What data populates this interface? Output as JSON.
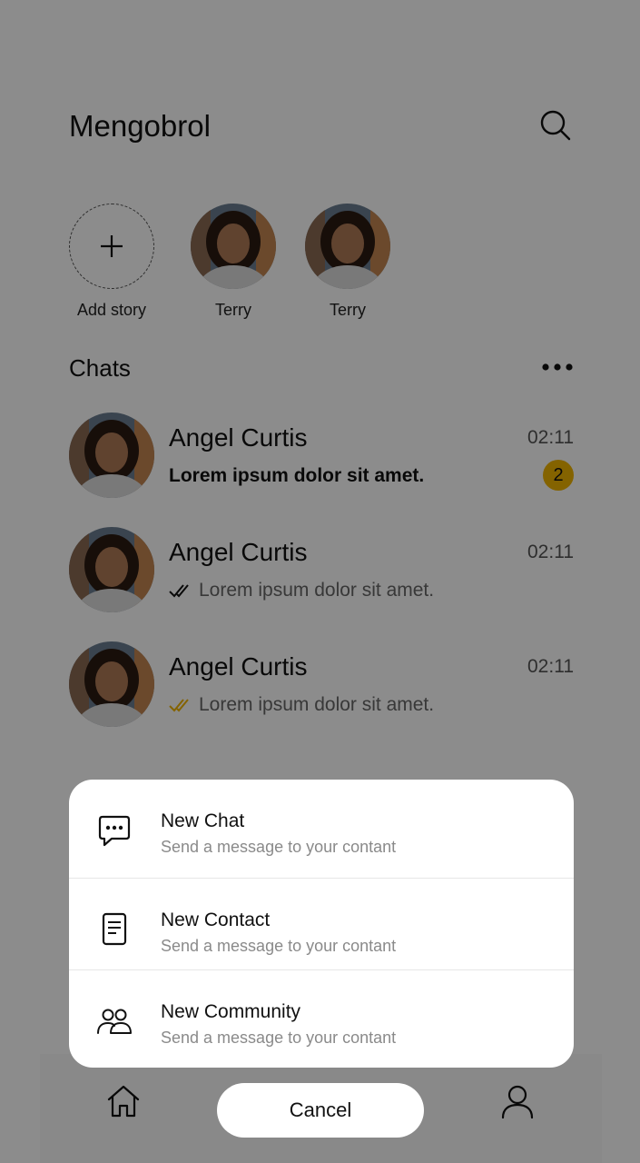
{
  "app": {
    "title": "Mengobrol"
  },
  "stories": [
    {
      "label": "Add story",
      "type": "add"
    },
    {
      "label": "Terry",
      "type": "person"
    },
    {
      "label": "Terry",
      "type": "person"
    }
  ],
  "chats": {
    "title": "Chats",
    "items": [
      {
        "name": "Angel Curtis",
        "time": "02:11",
        "preview": "Lorem ipsum dolor sit amet.",
        "unread_count": "2",
        "status": "unread"
      },
      {
        "name": "Angel Curtis",
        "time": "02:11",
        "preview": "Lorem ipsum dolor sit amet.",
        "status": "delivered"
      },
      {
        "name": "Angel Curtis",
        "time": "02:11",
        "preview": "Lorem ipsum dolor sit amet.",
        "status": "read"
      }
    ]
  },
  "sheet": {
    "items": [
      {
        "title": "New Chat",
        "subtitle": "Send a message to your contant",
        "icon": "chat-bubble-icon"
      },
      {
        "title": "New Contact",
        "subtitle": "Send a message to your contant",
        "icon": "contact-card-icon"
      },
      {
        "title": "New Community",
        "subtitle": "Send a message to your contant",
        "icon": "community-icon"
      }
    ],
    "cancel_label": "Cancel"
  },
  "nav": {
    "icons": [
      "home-icon",
      "profile-icon"
    ]
  },
  "colors": {
    "accent": "#F0B400",
    "overlay": "rgba(0,0,0,0.45)",
    "read_tick": "#F0B400",
    "delivered_tick": "#111111"
  }
}
